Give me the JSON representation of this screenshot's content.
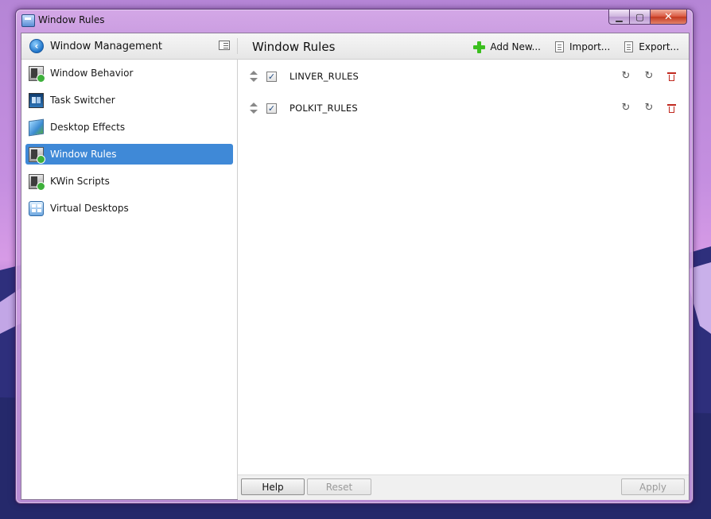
{
  "window": {
    "title": "Window Rules"
  },
  "header": {
    "back_title": "Window Management",
    "page_title": "Window Rules",
    "toolbar": {
      "add_new": "Add New...",
      "import": "Import...",
      "export": "Export..."
    }
  },
  "sidebar": {
    "items": [
      {
        "label": "Window Behavior",
        "icon": "window-behavior-icon",
        "selected": false
      },
      {
        "label": "Task Switcher",
        "icon": "task-switcher-icon",
        "selected": false
      },
      {
        "label": "Desktop Effects",
        "icon": "desktop-effects-icon",
        "selected": false
      },
      {
        "label": "Window Rules",
        "icon": "window-rules-icon",
        "selected": true
      },
      {
        "label": "KWin Scripts",
        "icon": "kwin-scripts-icon",
        "selected": false
      },
      {
        "label": "Virtual Desktops",
        "icon": "virtual-desktops-icon",
        "selected": false
      }
    ]
  },
  "rules": [
    {
      "name": "LINVER_RULES",
      "enabled": true
    },
    {
      "name": "POLKIT_RULES",
      "enabled": true
    }
  ],
  "footer": {
    "help": "Help",
    "reset": "Reset",
    "apply": "Apply"
  },
  "colors": {
    "selection": "#3f89d7",
    "add_icon": "#3bbf1f",
    "delete_icon": "#c0281e"
  }
}
